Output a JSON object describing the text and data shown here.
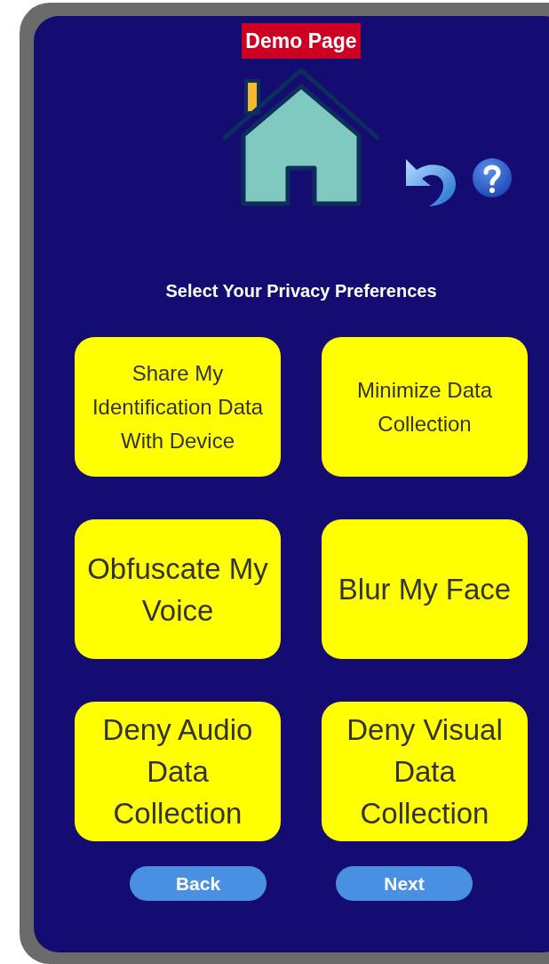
{
  "badge": "Demo Page",
  "heading": "Select Your Privacy Preferences",
  "options": [
    {
      "label": "Share My Identification Data With Device"
    },
    {
      "label": "Minimize Data Collection"
    },
    {
      "label": "Obfuscate My Voice"
    },
    {
      "label": "Blur My Face"
    },
    {
      "label": "Deny Audio Data Collection"
    },
    {
      "label": "Deny Visual Data Collection"
    }
  ],
  "buttons": [
    "Back",
    "Next"
  ]
}
